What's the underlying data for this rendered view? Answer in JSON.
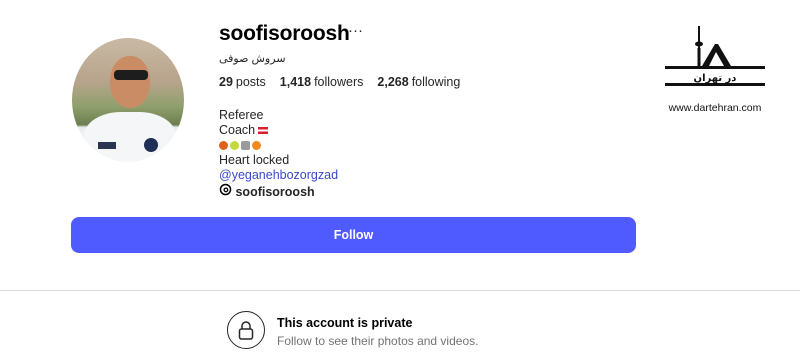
{
  "profile": {
    "username": "soofisoroosh",
    "more_icon": "···",
    "full_name": "سروش صوفی",
    "stats": {
      "posts_count": "29",
      "posts_label": "posts",
      "followers_count": "1,418",
      "followers_label": "followers",
      "following_count": "2,268",
      "following_label": "following"
    },
    "bio": {
      "line1": "Referee",
      "line2": "Coach",
      "line4": "Heart locked",
      "mention": "@yeganehbozorgzad",
      "threads_handle": "soofisoroosh"
    }
  },
  "actions": {
    "follow_label": "Follow"
  },
  "private": {
    "title": "This account is private",
    "subtitle": "Follow to see their photos and videos."
  },
  "watermark": {
    "logo_text": "در تهران",
    "url": "www.dartehran.com"
  },
  "colors": {
    "follow_button": "#4f5bff",
    "link": "#3b48c8",
    "divider": "#dbdbdb"
  }
}
